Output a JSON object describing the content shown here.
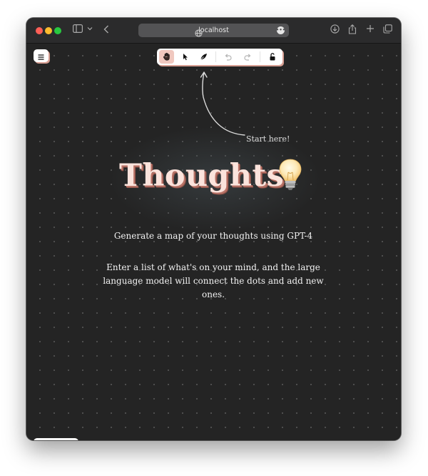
{
  "browser": {
    "url": "localhost"
  },
  "canvas": {
    "hint": "Start here!",
    "title": "Thoughts",
    "title_emoji": "lightbulb",
    "subtitle": "Generate a map of your thoughts using GPT-4",
    "description": "Enter a list of what's on your mind, and the large language model will connect the dots and add new ones."
  },
  "toolbar": {
    "tools": [
      "hand",
      "select",
      "draw",
      "undo",
      "redo",
      "lock"
    ],
    "active_tool": "hand"
  },
  "zoom_controls": {
    "minus": "−",
    "plus": "+"
  },
  "colors": {
    "accent_shadow": "#d79e92",
    "active_tool_bg": "#f0c8bf",
    "canvas_bg": "#242424",
    "title_fill": "#fbe3dc"
  }
}
